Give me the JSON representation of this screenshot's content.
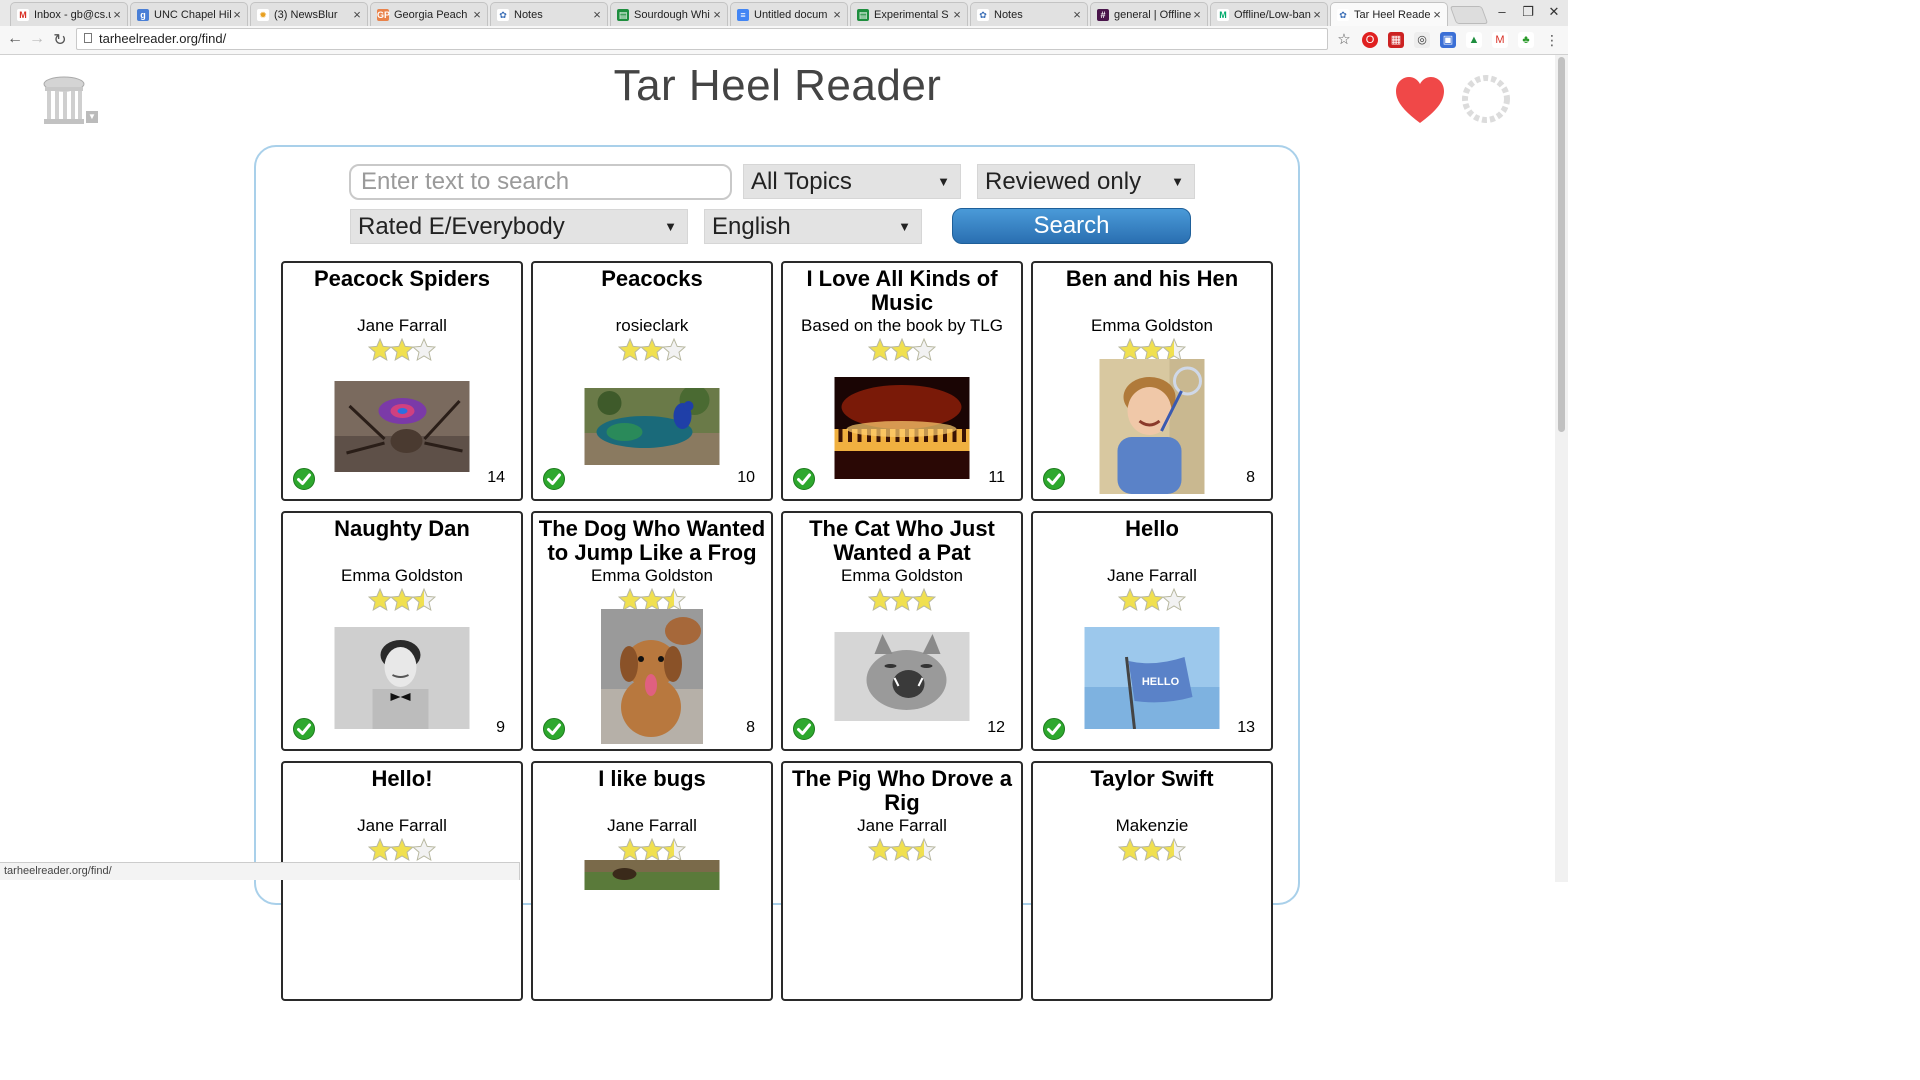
{
  "browser": {
    "tabs": [
      {
        "title": "Inbox - gb@cs.u",
        "fav": "M",
        "color": "#d93025",
        "fg": "#d93025",
        "bg": "#fff"
      },
      {
        "title": "UNC Chapel Hill",
        "fav": "g",
        "color": "#4a7fd6",
        "fg": "#fff",
        "bg": "#4a7fd6"
      },
      {
        "title": "(3) NewsBlur",
        "fav": "✹",
        "color": "#e8a020",
        "fg": "#e8a020",
        "bg": "#fff"
      },
      {
        "title": "Georgia Peach",
        "fav": "GP",
        "color": "#e9824a",
        "fg": "#fff",
        "bg": "#e9824a"
      },
      {
        "title": "Notes",
        "fav": "✿",
        "color": "#3b6fb7",
        "fg": "#3b6fb7",
        "bg": "#fff"
      },
      {
        "title": "Sourdough Whi",
        "fav": "▤",
        "color": "#1e8e3e",
        "fg": "#fff",
        "bg": "#1e8e3e"
      },
      {
        "title": "Untitled docum",
        "fav": "≡",
        "color": "#4285f4",
        "fg": "#fff",
        "bg": "#4285f4"
      },
      {
        "title": "Experimental S",
        "fav": "▤",
        "color": "#1e8e3e",
        "fg": "#fff",
        "bg": "#1e8e3e"
      },
      {
        "title": "Notes",
        "fav": "✿",
        "color": "#3b6fb7",
        "fg": "#3b6fb7",
        "bg": "#fff"
      },
      {
        "title": "general | Offline",
        "fav": "#",
        "color": "#4a154b",
        "fg": "#fff",
        "bg": "#4a154b"
      },
      {
        "title": "Offline/Low-ban",
        "fav": "M",
        "color": "#00ab6c",
        "fg": "#00ab6c",
        "bg": "#fff"
      },
      {
        "title": "Tar Heel Reader",
        "fav": "✿",
        "color": "#3b6fb7",
        "fg": "#3b6fb7",
        "bg": "#fff",
        "active": true
      }
    ],
    "url": "tarheelreader.org/find/",
    "status_url": "tarheelreader.org/find/"
  },
  "site": {
    "title": "Tar Heel Reader"
  },
  "search": {
    "placeholder": "Enter text to search",
    "topics": "All Topics",
    "review": "Reviewed only",
    "rating": "Rated E/Everybody",
    "language": "English",
    "button": "Search"
  },
  "books": [
    {
      "title": "Peacock Spiders",
      "author": "Jane Farrall",
      "rating": 2,
      "reviewed": true,
      "pages": "14",
      "image": "peacock-spider"
    },
    {
      "title": "Peacocks",
      "author": "rosieclark",
      "rating": 2,
      "reviewed": true,
      "pages": "10",
      "image": "peacock"
    },
    {
      "title": "I Love All Kinds of Music",
      "author": "Based on the book by TLG",
      "rating": 2,
      "reviewed": true,
      "pages": "11",
      "image": "piano-fire"
    },
    {
      "title": "Ben and his Hen",
      "author": "Emma Goldston",
      "rating": 2.5,
      "reviewed": true,
      "pages": "8",
      "image": "boy-bubble"
    },
    {
      "title": "Naughty Dan",
      "author": "Emma Goldston",
      "rating": 2.5,
      "reviewed": true,
      "pages": "9",
      "image": "boy-bowtie"
    },
    {
      "title": "The Dog Who Wanted to Jump Like a Frog",
      "author": "Emma Goldston",
      "rating": 2.5,
      "reviewed": true,
      "pages": "8",
      "image": "puppy"
    },
    {
      "title": "The Cat Who Just Wanted a Pat",
      "author": "Emma Goldston",
      "rating": 3,
      "reviewed": true,
      "pages": "12",
      "image": "cat-yawn"
    },
    {
      "title": "Hello",
      "author": "Jane Farrall",
      "rating": 2,
      "reviewed": true,
      "pages": "13",
      "image": "hello-flag"
    },
    {
      "title": "Hello!",
      "author": "Jane Farrall",
      "rating": 2,
      "reviewed": false,
      "pages": "",
      "image": ""
    },
    {
      "title": "I like bugs",
      "author": "Jane Farrall",
      "rating": 2.5,
      "reviewed": false,
      "pages": "",
      "image": "bugs"
    },
    {
      "title": "The Pig Who Drove a Rig",
      "author": "Jane Farrall",
      "rating": 2.5,
      "reviewed": false,
      "pages": "",
      "image": ""
    },
    {
      "title": "Taylor Swift",
      "author": "Makenzie",
      "rating": 2.5,
      "reviewed": false,
      "pages": "",
      "image": ""
    }
  ]
}
